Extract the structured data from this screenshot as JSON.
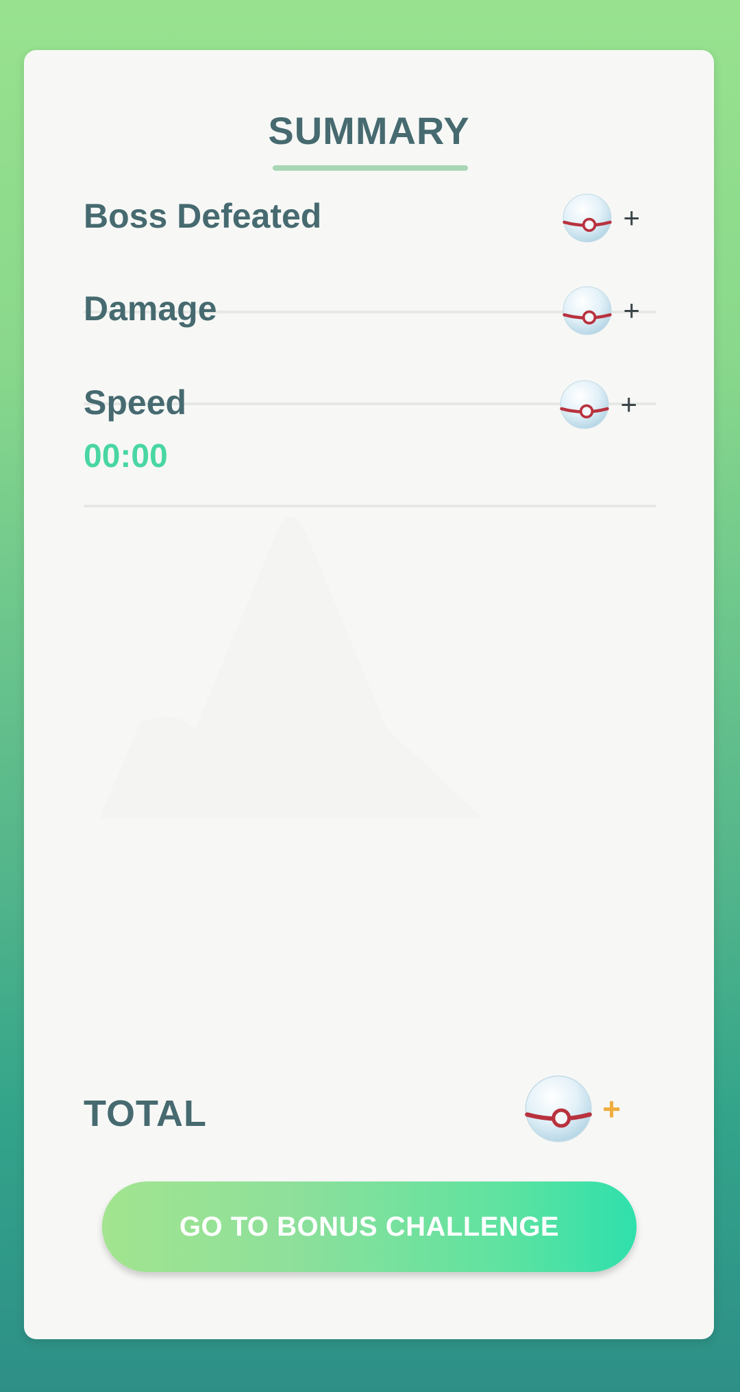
{
  "summary": {
    "title": "SUMMARY"
  },
  "rows": [
    {
      "label": "Boss Defeated",
      "reward_icon": "premier-ball-icon",
      "plus": "+"
    },
    {
      "label": "Damage",
      "reward_icon": "premier-ball-icon",
      "plus": "+"
    },
    {
      "label": "Speed",
      "reward_icon": "premier-ball-icon",
      "plus": "+",
      "time": "00:00"
    }
  ],
  "total": {
    "label": "TOTAL",
    "reward_icon": "premier-ball-icon",
    "plus": "+"
  },
  "cta": {
    "label": "GO TO BONUS CHALLENGE"
  },
  "colors": {
    "text_primary": "#466a70",
    "time_green": "#49d6a2",
    "total_plus_orange": "#efad3f",
    "cta_gradient_start": "#a2e48f",
    "cta_gradient_end": "#2fe0ac",
    "background_top": "#98e28f",
    "background_bottom": "#2e8f87"
  }
}
